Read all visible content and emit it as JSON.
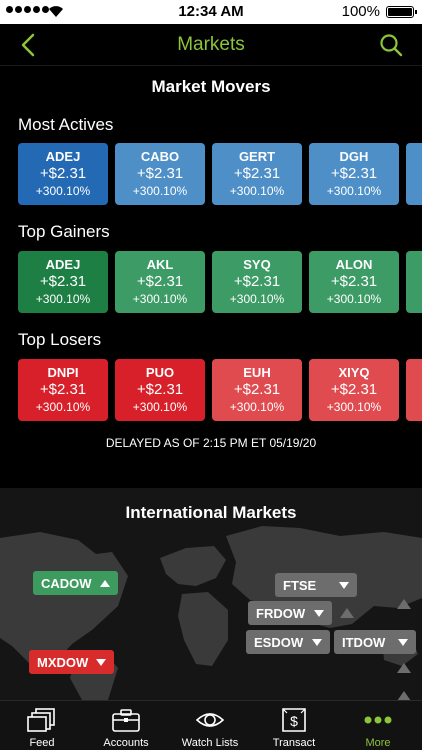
{
  "status_bar": {
    "time": "12:34 AM",
    "battery": "100%"
  },
  "nav": {
    "title": "Markets"
  },
  "movers": {
    "heading": "Market Movers",
    "groups": [
      {
        "label": "Most Actives",
        "tiles": [
          {
            "symbol": "ADEJ",
            "change": "+$2.31",
            "percent": "+300.10%",
            "color": "#2369b3"
          },
          {
            "symbol": "CABO",
            "change": "+$2.31",
            "percent": "+300.10%",
            "color": "#4e8fc8"
          },
          {
            "symbol": "GERT",
            "change": "+$2.31",
            "percent": "+300.10%",
            "color": "#4e8fc8"
          },
          {
            "symbol": "DGH",
            "change": "+$2.31",
            "percent": "+300.10%",
            "color": "#4e8fc8"
          },
          {
            "color": "#4e8fc8"
          }
        ]
      },
      {
        "label": "Top Gainers",
        "tiles": [
          {
            "symbol": "ADEJ",
            "change": "+$2.31",
            "percent": "+300.10%",
            "color": "#1e7f45"
          },
          {
            "symbol": "AKL",
            "change": "+$2.31",
            "percent": "+300.10%",
            "color": "#3d9b66"
          },
          {
            "symbol": "SYQ",
            "change": "+$2.31",
            "percent": "+300.10%",
            "color": "#3d9b66"
          },
          {
            "symbol": "ALON",
            "change": "+$2.31",
            "percent": "+300.10%",
            "color": "#3d9b66"
          },
          {
            "color": "#3d9b66"
          }
        ]
      },
      {
        "label": "Top Losers",
        "tiles": [
          {
            "symbol": "DNPI",
            "change": "+$2.31",
            "percent": "+300.10%",
            "color": "#d8202a"
          },
          {
            "symbol": "PUO",
            "change": "+$2.31",
            "percent": "+300.10%",
            "color": "#d8202a"
          },
          {
            "symbol": "EUH",
            "change": "+$2.31",
            "percent": "+300.10%",
            "color": "#e04b50"
          },
          {
            "symbol": "XIYQ",
            "change": "+$2.31",
            "percent": "+300.10%",
            "color": "#e04b50"
          },
          {
            "color": "#e04b50"
          }
        ]
      }
    ],
    "delayed": "DELAYED AS OF 2:15 PM ET 05/19/20"
  },
  "international": {
    "heading": "International Markets",
    "markets": {
      "cadow": "CADOW",
      "mxdow": "MXDOW",
      "ftse": "FTSE",
      "frdow": "FRDOW",
      "esdow": "ESDOW",
      "itdow": "ITDOW"
    }
  },
  "tabs": {
    "feed": "Feed",
    "accounts": "Accounts",
    "watch_lists": "Watch Lists",
    "transact": "Transact",
    "more": "More"
  },
  "colors": {
    "accent": "#8cc43a",
    "green": "#3d9b5f",
    "red": "#d82c2c",
    "grey": "#6d6d6d"
  }
}
